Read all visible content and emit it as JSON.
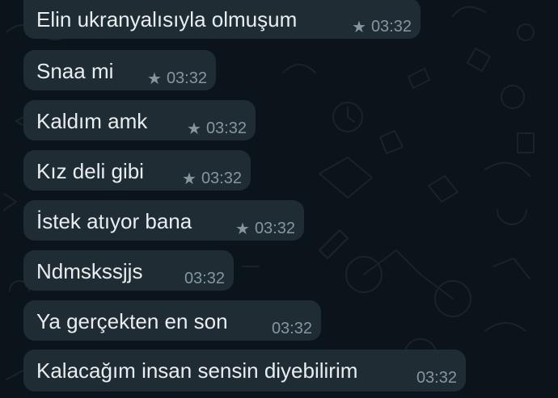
{
  "colors": {
    "background": "#0b141a",
    "bubble": "#1f2c34",
    "text": "#e9edef",
    "meta": "#8696a0"
  },
  "messages": [
    {
      "text": "Elin ukranyalısıyla olmuşum",
      "time": "03:32",
      "starred": true,
      "star_icon": "star-icon"
    },
    {
      "text": "Snaa mi",
      "time": "03:32",
      "starred": true,
      "star_icon": "star-icon"
    },
    {
      "text": "Kaldım amk",
      "time": "03:32",
      "starred": true,
      "star_icon": "star-icon"
    },
    {
      "text": "Kız deli gibi",
      "time": "03:32",
      "starred": true,
      "star_icon": "star-icon"
    },
    {
      "text": "İstek atıyor bana",
      "time": "03:32",
      "starred": true,
      "star_icon": "star-icon"
    },
    {
      "text": "Ndmskssjjs",
      "time": "03:32",
      "starred": false
    },
    {
      "text": "Ya gerçekten en son",
      "time": "03:32",
      "starred": false
    },
    {
      "text": "Kalacağım insan sensin diyebilirim",
      "time": "03:32",
      "starred": false
    }
  ]
}
